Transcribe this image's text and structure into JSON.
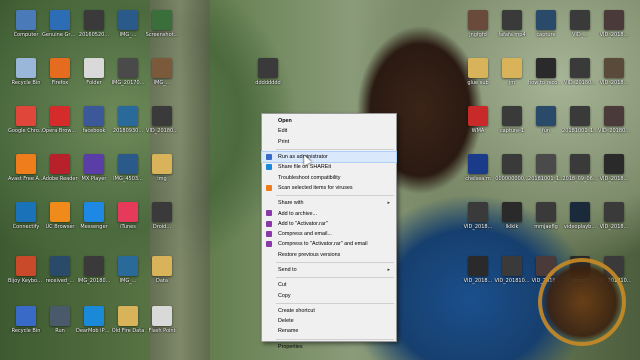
{
  "desktop_icons": [
    {
      "label": "Computer",
      "color": "#4a7ab8"
    },
    {
      "label": "Genuine Gratis",
      "color": "#2d6db5"
    },
    {
      "label": "20160520...",
      "color": "#3a3a3a"
    },
    {
      "label": "IMG_...",
      "color": "#2a5a8a"
    },
    {
      "label": "Screenshot...",
      "color": "#3a6e3a"
    },
    {
      "label": "Recycle Bin",
      "color": "#9ab6d8"
    },
    {
      "label": "Firefox",
      "color": "#e56b1f"
    },
    {
      "label": "Folder",
      "color": "#d9d9d9"
    },
    {
      "label": "IMG_20170...",
      "color": "#4a4a4a"
    },
    {
      "label": "IMG_...",
      "color": "#7a5a3a"
    },
    {
      "label": "Google Chrome",
      "color": "#e0463a"
    },
    {
      "label": "Opera Browser",
      "color": "#d62b2b"
    },
    {
      "label": "facebook",
      "color": "#3b5998"
    },
    {
      "label": "20180930...",
      "color": "#2a6a9a"
    },
    {
      "label": "VID_20180...",
      "color": "#3a3a3a"
    },
    {
      "label": "Avast Free Antivirus",
      "color": "#f07d1b"
    },
    {
      "label": "Adobe Reader",
      "color": "#b8212a"
    },
    {
      "label": "MX Player",
      "color": "#5b3da8"
    },
    {
      "label": "IMG_4503...",
      "color": "#2a5a8a"
    },
    {
      "label": "img",
      "color": "#d9b35a"
    },
    {
      "label": "Connectify",
      "color": "#1a73b8"
    },
    {
      "label": "UC Browser",
      "color": "#f08a1b"
    },
    {
      "label": "Messenger",
      "color": "#1e88e5"
    },
    {
      "label": "iTunes",
      "color": "#e63a5a"
    },
    {
      "label": "Droid...",
      "color": "#3a3a3a"
    },
    {
      "label": "Bijoy Keyboard",
      "color": "#c84a2a"
    },
    {
      "label": "received_...",
      "color": "#2a4a6a"
    },
    {
      "label": "IMG_20180...",
      "color": "#3a3a3a"
    },
    {
      "label": "IMG_...",
      "color": "#2a6a9a"
    },
    {
      "label": "Data",
      "color": "#d9b35a"
    },
    {
      "label": "Recycle Bin",
      "color": "#3a6ac8"
    },
    {
      "label": "Run",
      "color": "#4a5a6a"
    },
    {
      "label": "DearMob iPhone",
      "color": "#1a8ad8"
    },
    {
      "label": "Old Fire Data",
      "color": "#d9b35a"
    },
    {
      "label": "Flash Point",
      "color": "#d9d9d9"
    },
    {
      "label": "dddddddd",
      "color": "#3a3a3a"
    },
    {
      "label": "jngfgfd",
      "color": "#6a4a3a"
    },
    {
      "label": "fafafa.mp4",
      "color": "#3a3a3a"
    },
    {
      "label": "capture",
      "color": "#2a4a6a"
    },
    {
      "label": "VID_...",
      "color": "#3a3a3a"
    },
    {
      "label": "VID_2018...",
      "color": "#4a3a3a"
    },
    {
      "label": "glue sub",
      "color": "#d9b35a"
    },
    {
      "label": "jm",
      "color": "#d9b35a"
    },
    {
      "label": "how to recover...",
      "color": "#2a2a2a"
    },
    {
      "label": "VID_20180...",
      "color": "#3a3a3a"
    },
    {
      "label": "VID_2018...",
      "color": "#5a4a3a"
    },
    {
      "label": "WMA",
      "color": "#c82a2a"
    },
    {
      "label": "capture-1",
      "color": "#3a3a3a"
    },
    {
      "label": "fun",
      "color": "#2a4a6a"
    },
    {
      "label": "20181001_1...",
      "color": "#3a3a3a"
    },
    {
      "label": "VID_20180...",
      "color": "#4a3a3a"
    },
    {
      "label": "chelsea m",
      "color": "#1a3a8a"
    },
    {
      "label": "000000000...",
      "color": "#3a3a3a"
    },
    {
      "label": "20181001_1...",
      "color": "#4a4a4a"
    },
    {
      "label": "2018_09_06...",
      "color": "#3a3a3a"
    },
    {
      "label": "VID_2018...",
      "color": "#2a2a2a"
    },
    {
      "label": "VID_2018...",
      "color": "#3a3a3a"
    },
    {
      "label": "lklklk",
      "color": "#2a2a2a"
    },
    {
      "label": "mmjaeflg",
      "color": "#3a3a3a"
    },
    {
      "label": "videoplayb...",
      "color": "#1a2a3a"
    },
    {
      "label": "VID_2018...",
      "color": "#3a3a3a"
    },
    {
      "label": "VID_2018...",
      "color": "#2a2a2a"
    },
    {
      "label": "VID_201810...",
      "color": "#3a3a3a"
    },
    {
      "label": "VID_2018...",
      "color": "#4a3a3a"
    },
    {
      "label": "cccccc",
      "color": "#2a2a2a"
    },
    {
      "label": "VID_201810...",
      "color": "#3a3a3a"
    }
  ],
  "context_menu": {
    "groups": [
      [
        {
          "label": "Open",
          "bold": true,
          "icon": null
        },
        {
          "label": "Edit",
          "icon": null
        },
        {
          "label": "Print",
          "icon": null
        }
      ],
      [
        {
          "label": "Run as administrator",
          "icon": "shield-icon",
          "icon_color": "#3a6ac8",
          "highlighted": true
        },
        {
          "label": "Share file on SHAREit",
          "icon": "shareit-icon",
          "icon_color": "#1a8ad8"
        },
        {
          "label": "Troubleshoot compatibility",
          "icon": null
        },
        {
          "label": "Scan selected items for viruses",
          "icon": "avast-icon",
          "icon_color": "#f07d1b"
        }
      ],
      [
        {
          "label": "Share with",
          "icon": null,
          "submenu": true
        },
        {
          "label": "Add to archive...",
          "icon": "winrar-icon",
          "icon_color": "#8a3aa8"
        },
        {
          "label": "Add to \"Activator.rar\"",
          "icon": "winrar-icon",
          "icon_color": "#8a3aa8"
        },
        {
          "label": "Compress and email...",
          "icon": "winrar-icon",
          "icon_color": "#8a3aa8"
        },
        {
          "label": "Compress to \"Activator.rar\" and email",
          "icon": "winrar-icon",
          "icon_color": "#8a3aa8"
        },
        {
          "label": "Restore previous versions",
          "icon": null
        }
      ],
      [
        {
          "label": "Send to",
          "icon": null,
          "submenu": true
        }
      ],
      [
        {
          "label": "Cut",
          "icon": null
        },
        {
          "label": "Copy",
          "icon": null
        }
      ],
      [
        {
          "label": "Create shortcut",
          "icon": null
        },
        {
          "label": "Delete",
          "icon": null
        },
        {
          "label": "Rename",
          "icon": null
        }
      ],
      [
        {
          "label": "Properties",
          "icon": null
        }
      ]
    ]
  }
}
